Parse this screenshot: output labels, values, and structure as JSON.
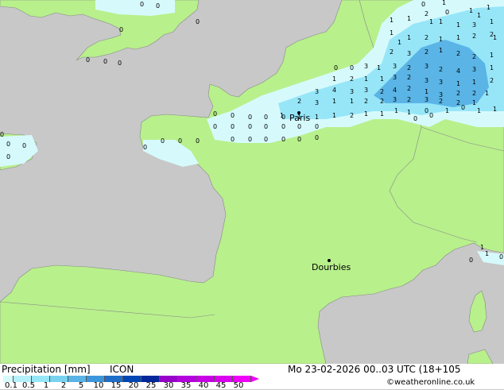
{
  "footer": {
    "title": "Precipitation [mm]",
    "model": "ICON",
    "datetime": "Mo 23-02-2026 00..03 UTC (18+105",
    "credit": "©weatheronline.co.uk"
  },
  "legend": {
    "ticks": [
      "0.1",
      "0.5",
      "1",
      "2",
      "5",
      "10",
      "15",
      "20",
      "25",
      "30",
      "35",
      "40",
      "45",
      "50"
    ],
    "colors": [
      "#d6fafc",
      "#b4f0fa",
      "#96e6f8",
      "#78d2f0",
      "#5ab4e6",
      "#3c96dc",
      "#1e6ec8",
      "#0046b4",
      "#00289b",
      "#9600c8",
      "#b400dc",
      "#c800e6",
      "#dc00f0",
      "#f000fa"
    ]
  },
  "cities": [
    {
      "name": "Paris"
    },
    {
      "name": "Dourbies"
    }
  ],
  "colors": {
    "sea": "#c8c8c8",
    "land": "#b8f08c",
    "precip_light": "#d6fafc",
    "precip_mid": "#96e6f8",
    "precip_heavy": "#5ab4e6"
  },
  "precip_values": [
    "0",
    "1",
    "1",
    "1",
    "1",
    "1",
    "2",
    "1",
    "1",
    "3",
    "1",
    "1",
    "1",
    "2",
    "1",
    "1",
    "2",
    "2",
    "2",
    "3",
    "2",
    "1",
    "2",
    "2",
    "1",
    "3",
    "1",
    "3",
    "2",
    "3",
    "2",
    "4",
    "3",
    "1",
    "1",
    "2",
    "1",
    "1",
    "3",
    "2",
    "3",
    "3",
    "1",
    "1",
    "2",
    "3",
    "4",
    "3",
    "3",
    "2",
    "4",
    "2",
    "1",
    "3",
    "2",
    "2",
    "1",
    "2",
    "3",
    "1",
    "1",
    "2",
    "2",
    "3",
    "2",
    "3",
    "2",
    "2",
    "1",
    "1",
    "1",
    "1",
    "1",
    "2",
    "1",
    "1",
    "1",
    "1",
    "0",
    "0",
    "0",
    "0",
    "0",
    "0",
    "0",
    "0",
    "0",
    "0",
    "0",
    "0",
    "0",
    "0",
    "0",
    "0",
    "0",
    "0",
    "0",
    "0",
    "0",
    "0",
    "0",
    "0",
    "0",
    "0",
    "0",
    "0",
    "0",
    "0",
    "0",
    "0",
    "0",
    "0",
    "1",
    "1",
    "0",
    "0",
    "0",
    "0",
    "1",
    "0",
    "1",
    "1",
    "0",
    "1",
    "1",
    "0",
    "0",
    "1",
    "1",
    "0",
    "0",
    "0"
  ]
}
